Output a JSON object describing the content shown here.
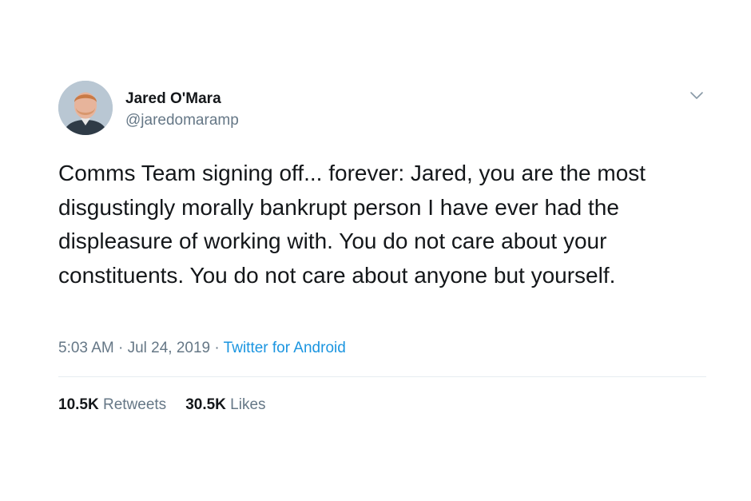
{
  "tweet": {
    "author": {
      "display_name": "Jared O'Mara",
      "handle": "@jaredomaramp"
    },
    "text": "Comms Team signing off... forever: Jared, you are the most disgustingly morally bankrupt person I have ever had the displeasure of working with. You do not care about your constituents. You do not care about anyone but yourself.",
    "timestamp": "5:03 AM · Jul 24, 2019 · ",
    "source": "Twitter for Android",
    "stats": {
      "retweets_count": "10.5K",
      "retweets_label": " Retweets",
      "likes_count": "30.5K",
      "likes_label": " Likes"
    },
    "icons": {
      "menu": "chevron-down-icon"
    },
    "colors": {
      "text": "#14171a",
      "secondary": "#657786",
      "link": "#1b95e0",
      "divider": "#e6ecf0"
    }
  }
}
